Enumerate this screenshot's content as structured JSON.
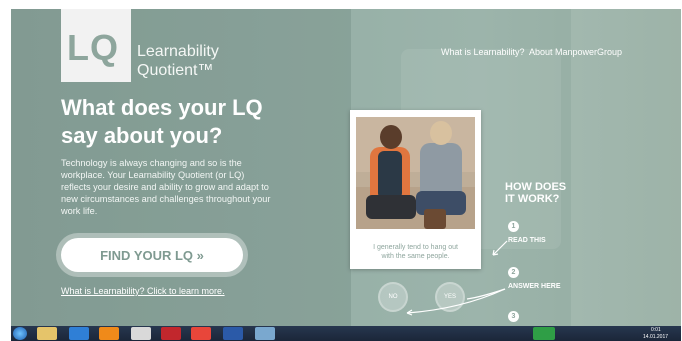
{
  "brand": {
    "logo_letters": "LQ",
    "name_line1": "Learnability",
    "name_line2": "Quotient™"
  },
  "nav": {
    "what_is": "What is Learnability?",
    "about": "About ManpowerGroup"
  },
  "hero": {
    "title_line1": "What does your LQ",
    "title_line2": "say about you?",
    "body_lines": [
      "Technology is always changing and so is the",
      "workplace. Your Learnability Quotient (or LQ)",
      "reflects your desire and ability to grow and adapt to",
      "new circumstances and challenges throughout your",
      "work life."
    ],
    "cta_label": "FIND YOUR LQ »",
    "learn_more_link": "What is Learnability? Click to learn more."
  },
  "card": {
    "statement_line1": "I generally tend to hang out",
    "statement_line2": "with the same people."
  },
  "how": {
    "title_line1": "HOW DOES",
    "title_line2": "IT WORK?",
    "steps": [
      {
        "num": "1",
        "label": "READ THIS"
      },
      {
        "num": "2",
        "label": "ANSWER HERE"
      },
      {
        "num": "3",
        "label": ""
      }
    ]
  },
  "answers": {
    "no": "NO",
    "yes": "YES"
  },
  "taskbar": {
    "time": "0:01",
    "date": "14.01.2017"
  },
  "colors": {
    "page_bg": "#9cb4ab",
    "accent_text": "#7f9a91",
    "taskbar": "#1f2c41"
  }
}
